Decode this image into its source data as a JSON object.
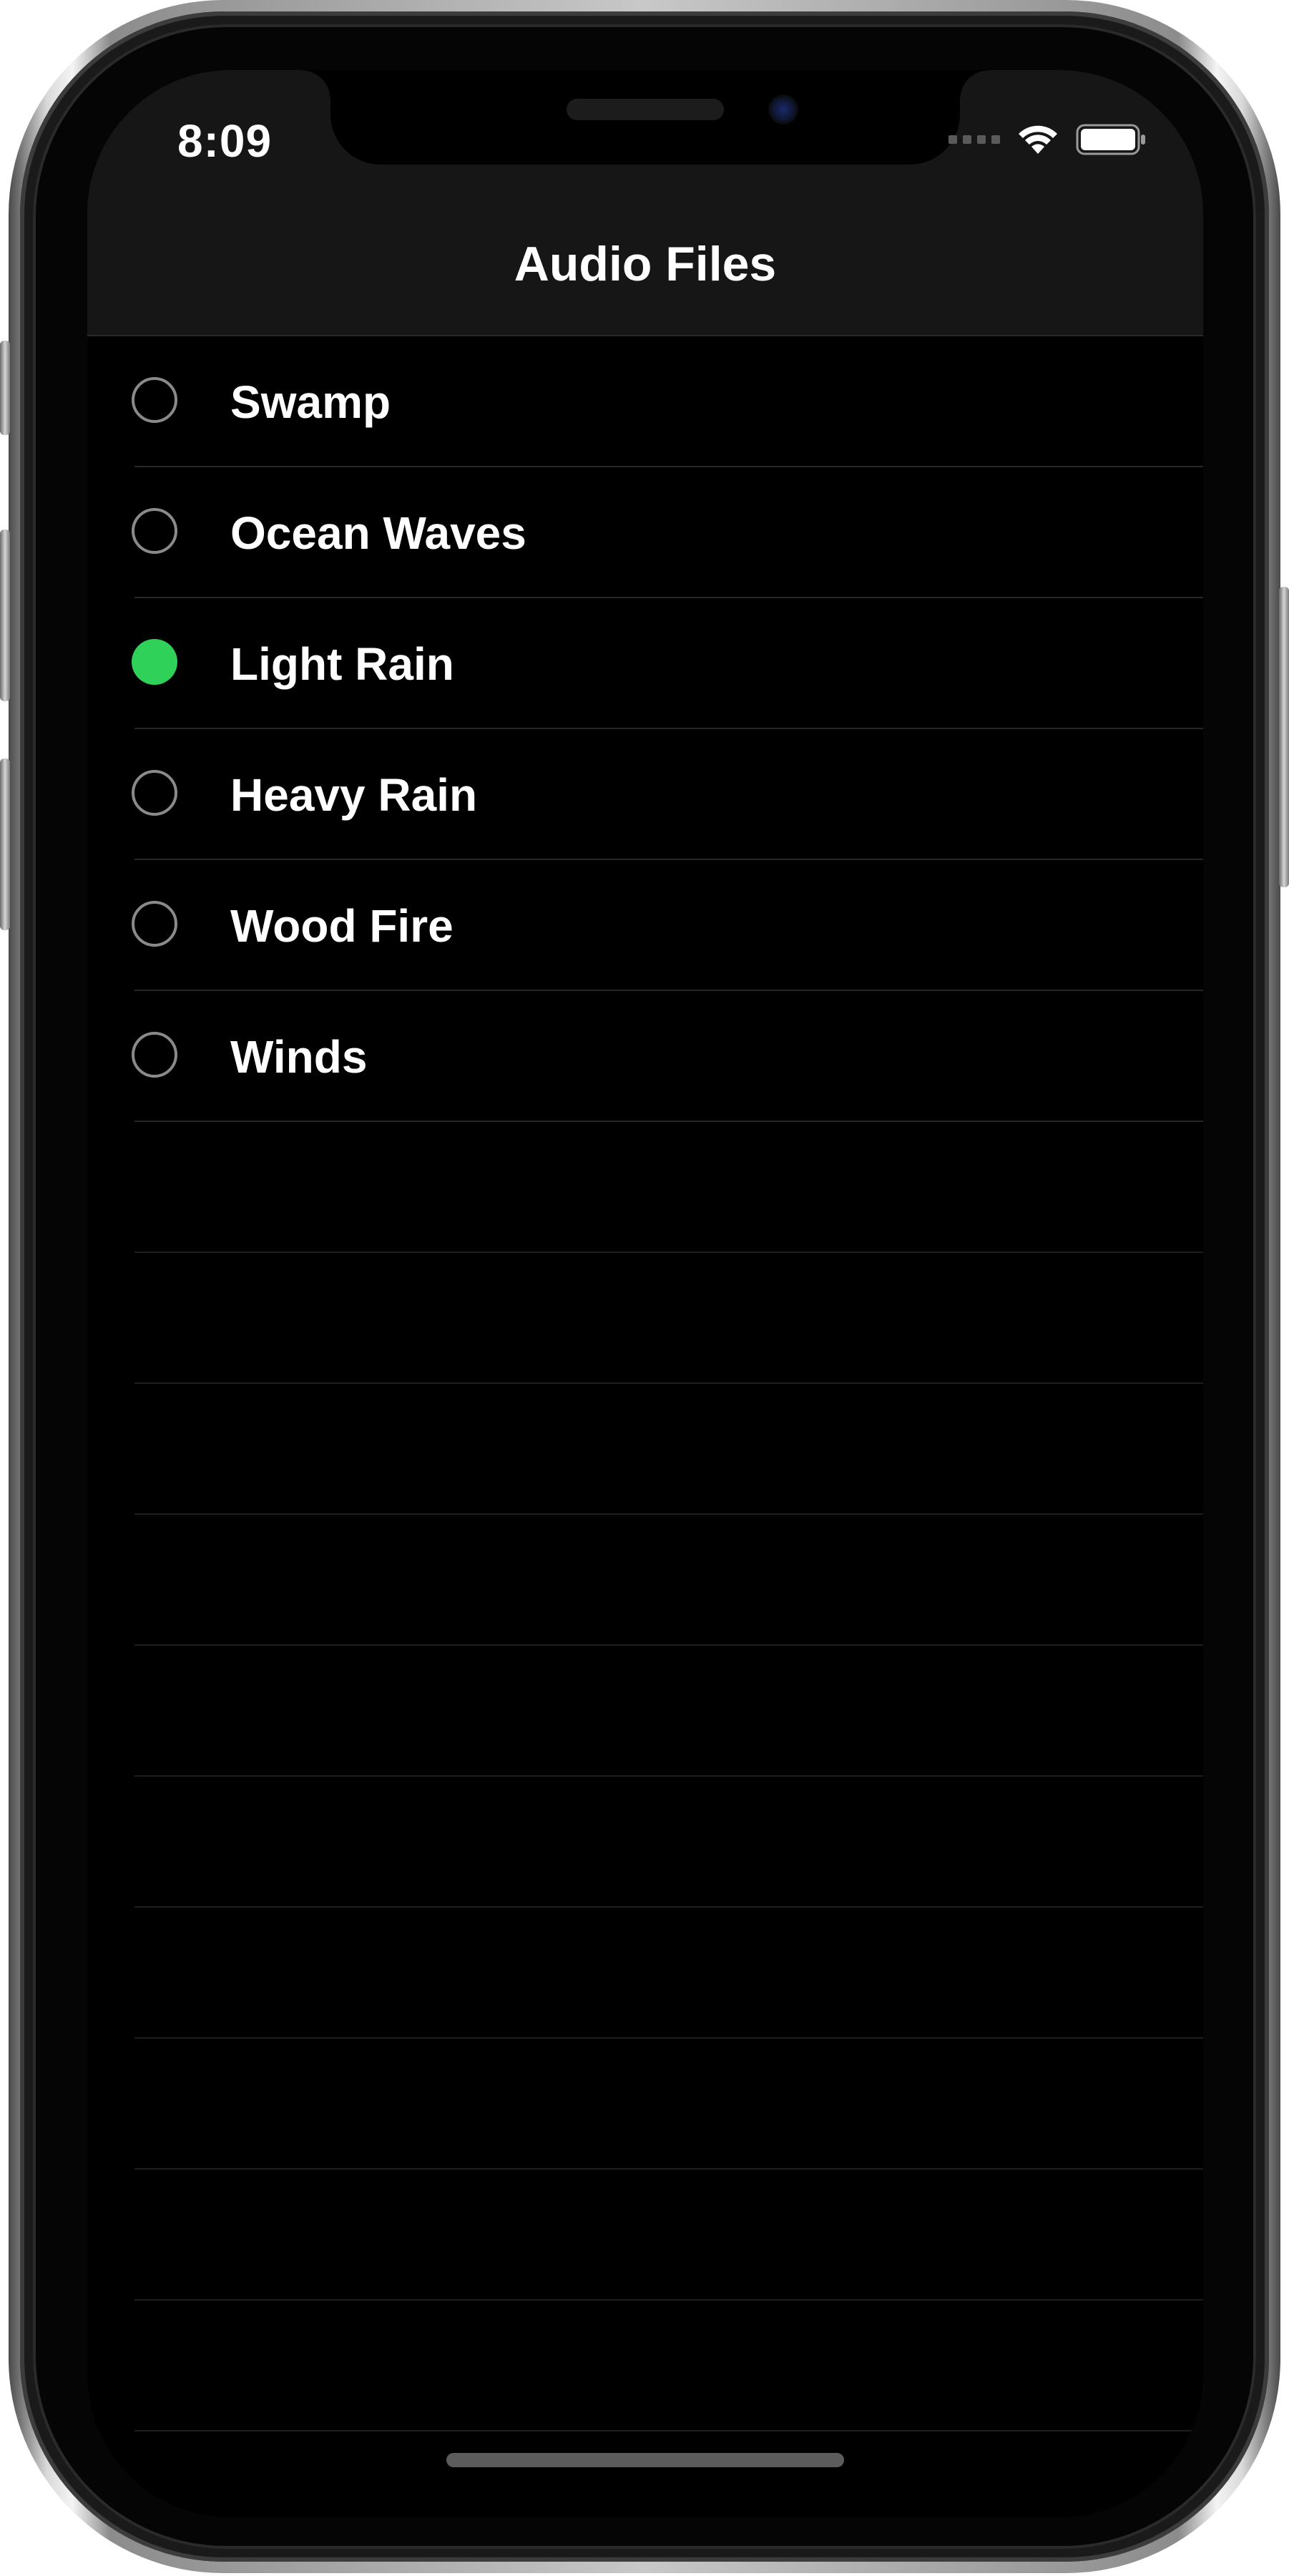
{
  "status_bar": {
    "time": "8:09",
    "wifi_icon": "wifi-icon",
    "battery_icon": "battery-full-icon"
  },
  "navbar": {
    "title": "Audio Files"
  },
  "audio_list": {
    "items": [
      {
        "label": "Swamp",
        "selected": false
      },
      {
        "label": "Ocean Waves",
        "selected": false
      },
      {
        "label": "Light Rain",
        "selected": true
      },
      {
        "label": "Heavy Rain",
        "selected": false
      },
      {
        "label": "Wood Fire",
        "selected": false
      },
      {
        "label": "Winds",
        "selected": false
      }
    ]
  },
  "colors": {
    "selected_accent": "#30d158",
    "background": "#000000",
    "navbar_background": "#161616"
  }
}
